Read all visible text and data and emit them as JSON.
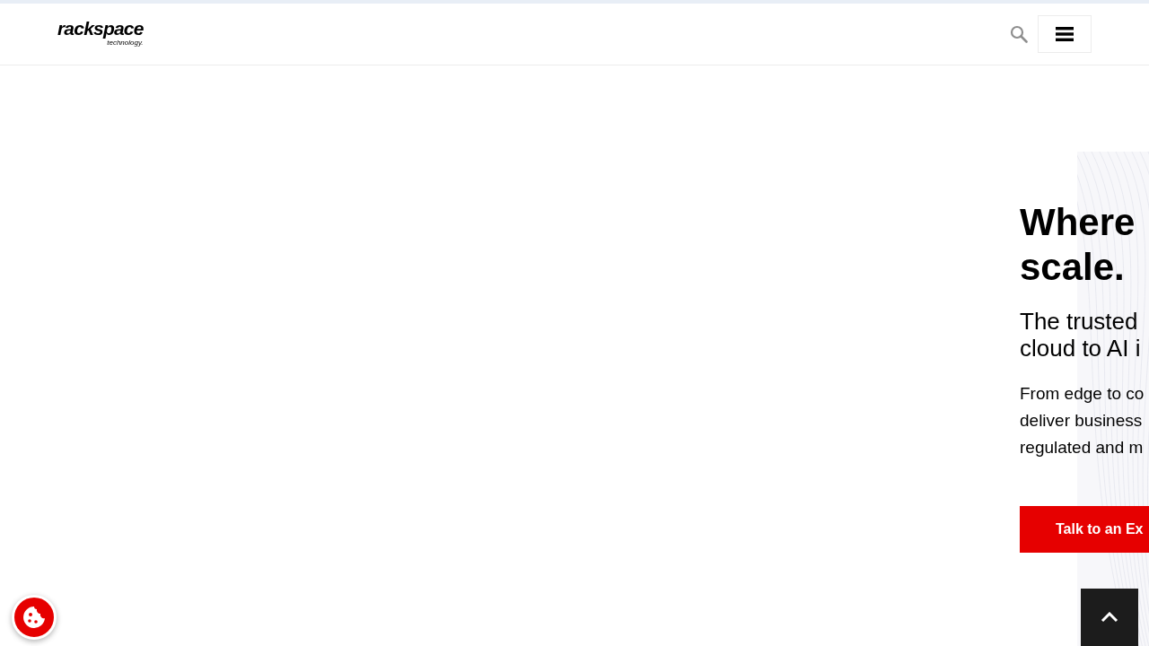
{
  "header": {
    "logo": {
      "wordmark": "rackspace",
      "tagline": "technology."
    }
  },
  "hero": {
    "headline_lines": [
      "Where",
      "scale."
    ],
    "subtitle_lines": [
      "The trusted",
      "cloud to AI i"
    ],
    "body_lines": [
      "From edge to co",
      "deliver business",
      "regulated and m"
    ],
    "cta": {
      "label": "Talk to an Ex"
    }
  }
}
